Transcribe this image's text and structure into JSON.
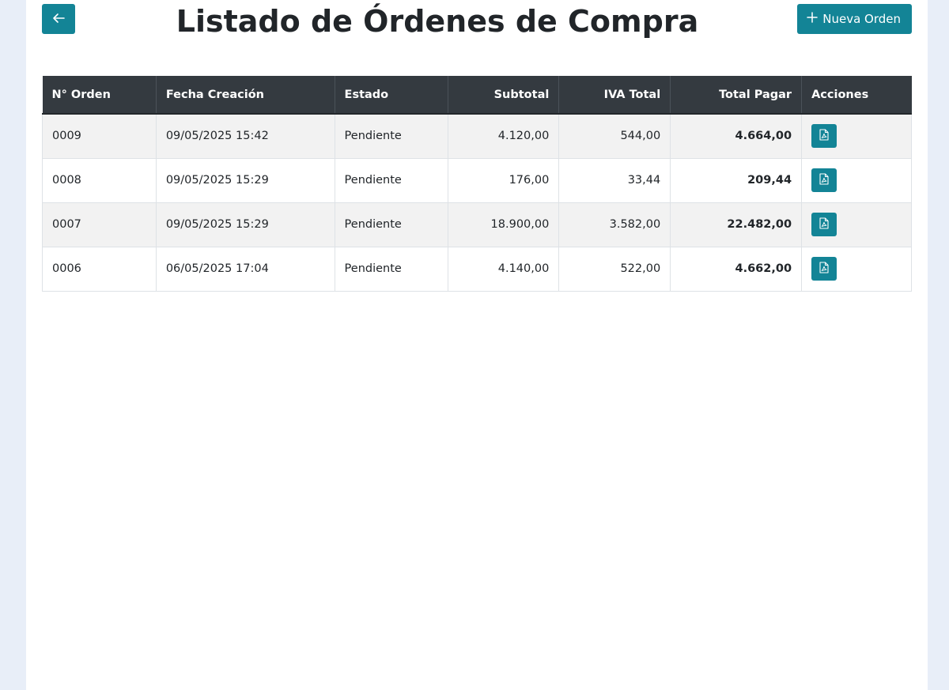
{
  "header": {
    "title": "Listado de Órdenes de Compra",
    "new_order_label": "Nueva Orden",
    "back_icon": "arrow-left-icon",
    "new_icon": "plus-icon"
  },
  "colors": {
    "accent": "#138496",
    "header_bg": "#343a40",
    "page_bg": "#e8eef8"
  },
  "table": {
    "columns": [
      "N° Orden",
      "Fecha Creación",
      "Estado",
      "Subtotal",
      "IVA Total",
      "Total Pagar",
      "Acciones"
    ],
    "rows": [
      {
        "order": "0009",
        "date": "09/05/2025 15:42",
        "status": "Pendiente",
        "subtotal": "4.120,00",
        "iva": "544,00",
        "total": "4.664,00"
      },
      {
        "order": "0008",
        "date": "09/05/2025 15:29",
        "status": "Pendiente",
        "subtotal": "176,00",
        "iva": "33,44",
        "total": "209,44"
      },
      {
        "order": "0007",
        "date": "09/05/2025 15:29",
        "status": "Pendiente",
        "subtotal": "18.900,00",
        "iva": "3.582,00",
        "total": "22.482,00"
      },
      {
        "order": "0006",
        "date": "06/05/2025 17:04",
        "status": "Pendiente",
        "subtotal": "4.140,00",
        "iva": "522,00",
        "total": "4.662,00"
      }
    ],
    "action_icon": "file-pdf-icon"
  }
}
